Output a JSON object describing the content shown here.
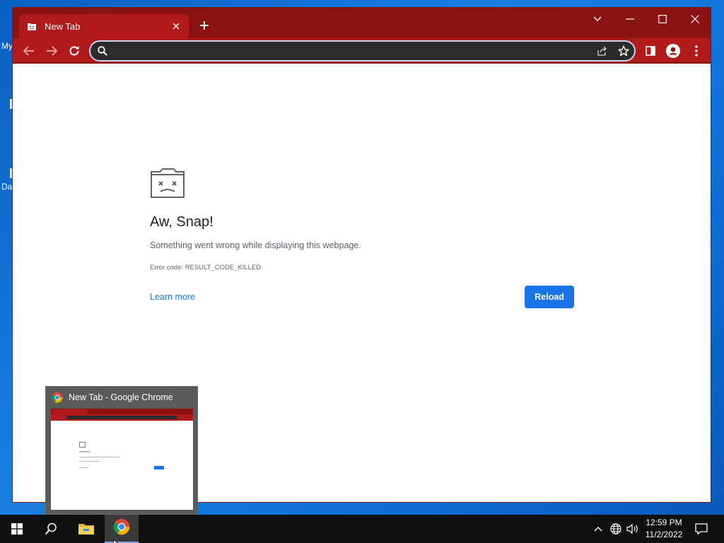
{
  "desktop": {
    "icon_fragments": [
      "My",
      "Da"
    ]
  },
  "browser": {
    "tab": {
      "title": "New Tab",
      "favicon": "sad-tab-icon"
    },
    "window_controls": [
      "tab-search",
      "minimize",
      "maximize",
      "close"
    ],
    "omnibox": {
      "value": "",
      "placeholder": ""
    },
    "colors": {
      "frame": "#8b1212",
      "toolbar": "#b11a1a",
      "omnibox_bg": "#2b2b2b",
      "accent": "#1a73e8"
    }
  },
  "error_page": {
    "title": "Aw, Snap!",
    "message": "Something went wrong while displaying this webpage.",
    "error_code": "Error code: RESULT_CODE_KILLED",
    "learn_more": "Learn more",
    "reload": "Reload"
  },
  "taskbar": {
    "preview": {
      "title": "New Tab - Google Chrome"
    },
    "clock": {
      "time": "12:59 PM",
      "date": "11/2/2022"
    },
    "pinned": [
      "windows-start-icon",
      "search-icon",
      "file-explorer-icon",
      "chrome-icon"
    ],
    "tray": [
      "show-hidden-icons-icon",
      "network-icon",
      "volume-icon",
      "action-center-icon"
    ]
  }
}
